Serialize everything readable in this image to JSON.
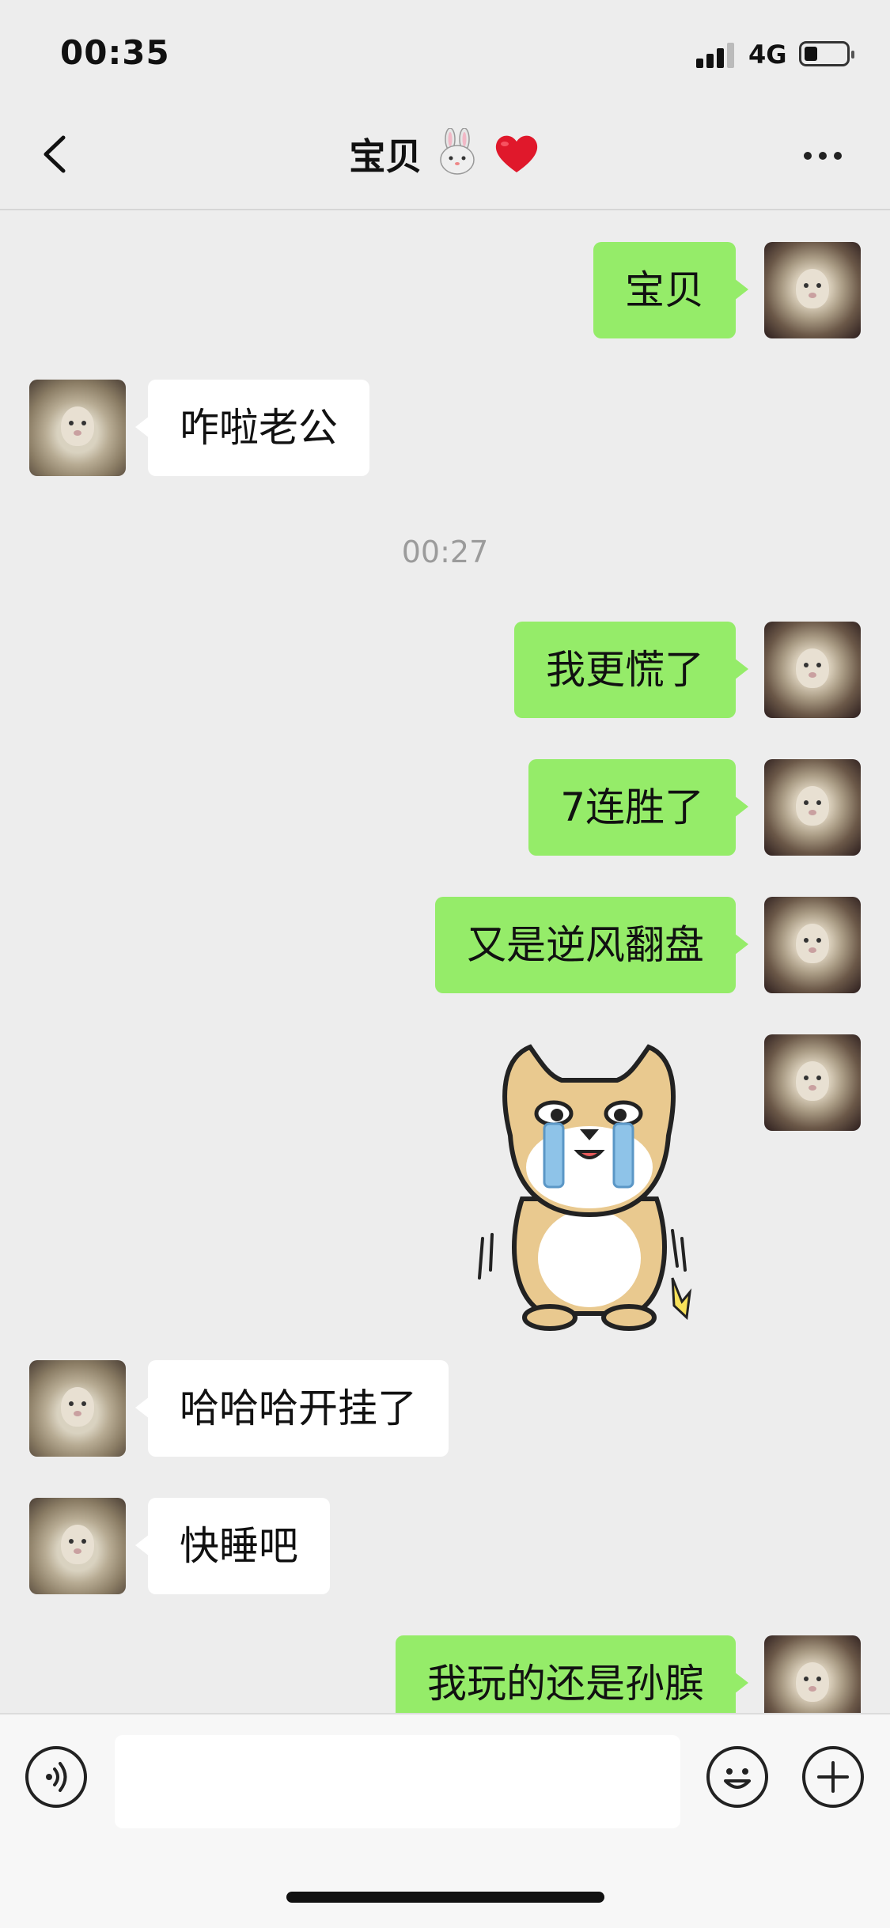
{
  "status_bar": {
    "time": "00:35",
    "network": "4G",
    "battery_icon": "battery-low-icon"
  },
  "nav": {
    "title": "宝贝",
    "back_icon": "chevron-left-icon",
    "more_icon": "more-dots-icon"
  },
  "chat": {
    "timestamp": "00:27",
    "messages": [
      {
        "side": "out",
        "text": "宝贝"
      },
      {
        "side": "in",
        "text": "咋啦老公"
      },
      {
        "side": "out",
        "text": "我更慌了"
      },
      {
        "side": "out",
        "text": "7连胜了"
      },
      {
        "side": "out",
        "text": "又是逆风翻盘"
      },
      {
        "side": "out",
        "type": "sticker",
        "sticker": "crying-dog-sticker"
      },
      {
        "side": "in",
        "text": "哈哈哈开挂了"
      },
      {
        "side": "in",
        "text": "快睡吧"
      },
      {
        "side": "out",
        "text": "我玩的还是孙膑"
      }
    ]
  },
  "input_bar": {
    "voice_icon": "voice-icon",
    "emoji_icon": "emoji-icon",
    "plus_icon": "plus-icon",
    "message_value": ""
  },
  "colors": {
    "background": "#EDEDED",
    "outgoing_bubble": "#95EC69",
    "incoming_bubble": "#FFFFFF",
    "timestamp": "#9B9B9B"
  }
}
